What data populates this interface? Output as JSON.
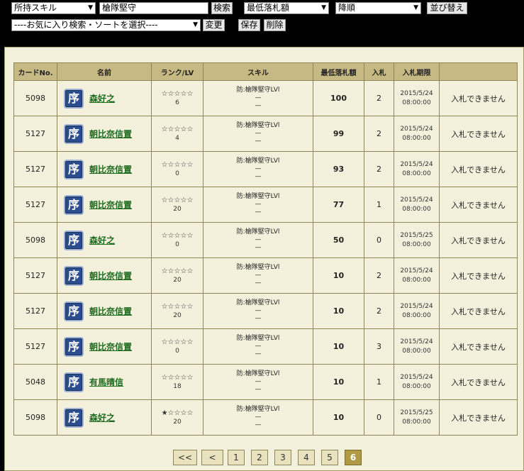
{
  "search": {
    "skill_select": "所持スキル",
    "skill_query": "槍隊堅守",
    "search_button": "検索",
    "sort_field": "最低落札額",
    "sort_order": "降順",
    "sort_button": "並び替え",
    "favorite_select": "----お気に入り検索・ソートを選択----",
    "change_button": "変更",
    "save_button": "保存",
    "delete_button": "削除"
  },
  "table": {
    "headers": [
      "カードNo.",
      "名前",
      "ランク/LV",
      "スキル",
      "最低落札額",
      "入札",
      "入札期限",
      ""
    ],
    "badge_text": "序",
    "rows": [
      {
        "card_no": "5098",
        "name": "森好之",
        "stars": "☆☆☆☆☆",
        "lv": "6",
        "skill1": "防:槍隊堅守LVl",
        "skill2": "—",
        "skill3": "—",
        "price": "100",
        "bids": "2",
        "end_date": "2015/5/24",
        "end_time": "08:00:00",
        "status": "入札できません"
      },
      {
        "card_no": "5127",
        "name": "朝比奈信置",
        "stars": "☆☆☆☆☆",
        "lv": "4",
        "skill1": "防:槍隊堅守LVl",
        "skill2": "—",
        "skill3": "—",
        "price": "99",
        "bids": "2",
        "end_date": "2015/5/24",
        "end_time": "08:00:00",
        "status": "入札できません"
      },
      {
        "card_no": "5127",
        "name": "朝比奈信置",
        "stars": "☆☆☆☆☆",
        "lv": "0",
        "skill1": "防:槍隊堅守LVl",
        "skill2": "—",
        "skill3": "—",
        "price": "93",
        "bids": "2",
        "end_date": "2015/5/24",
        "end_time": "08:00:00",
        "status": "入札できません"
      },
      {
        "card_no": "5127",
        "name": "朝比奈信置",
        "stars": "☆☆☆☆☆",
        "lv": "20",
        "skill1": "防:槍隊堅守LVl",
        "skill2": "—",
        "skill3": "—",
        "price": "77",
        "bids": "1",
        "end_date": "2015/5/24",
        "end_time": "08:00:00",
        "status": "入札できません"
      },
      {
        "card_no": "5098",
        "name": "森好之",
        "stars": "☆☆☆☆☆",
        "lv": "0",
        "skill1": "防:槍隊堅守LVl",
        "skill2": "—",
        "skill3": "—",
        "price": "50",
        "bids": "0",
        "end_date": "2015/5/25",
        "end_time": "08:00:00",
        "status": "入札できません"
      },
      {
        "card_no": "5127",
        "name": "朝比奈信置",
        "stars": "☆☆☆☆☆",
        "lv": "20",
        "skill1": "防:槍隊堅守LVl",
        "skill2": "—",
        "skill3": "—",
        "price": "10",
        "bids": "2",
        "end_date": "2015/5/24",
        "end_time": "08:00:00",
        "status": "入札できません"
      },
      {
        "card_no": "5127",
        "name": "朝比奈信置",
        "stars": "☆☆☆☆☆",
        "lv": "20",
        "skill1": "防:槍隊堅守LVl",
        "skill2": "—",
        "skill3": "—",
        "price": "10",
        "bids": "2",
        "end_date": "2015/5/24",
        "end_time": "08:00:00",
        "status": "入札できません"
      },
      {
        "card_no": "5127",
        "name": "朝比奈信置",
        "stars": "☆☆☆☆☆",
        "lv": "0",
        "skill1": "防:槍隊堅守LVl",
        "skill2": "—",
        "skill3": "—",
        "price": "10",
        "bids": "3",
        "end_date": "2015/5/24",
        "end_time": "08:00:00",
        "status": "入札できません"
      },
      {
        "card_no": "5048",
        "name": "有馬晴信",
        "stars": "☆☆☆☆☆",
        "lv": "18",
        "skill1": "防:槍隊堅守LVl",
        "skill2": "—",
        "skill3": "—",
        "price": "10",
        "bids": "1",
        "end_date": "2015/5/24",
        "end_time": "08:00:00",
        "status": "入札できません"
      },
      {
        "card_no": "5098",
        "name": "森好之",
        "stars": "★☆☆☆☆",
        "lv": "20",
        "skill1": "防:槍隊堅守LVl",
        "skill2": "—",
        "skill3": "—",
        "price": "10",
        "bids": "0",
        "end_date": "2015/5/25",
        "end_time": "08:00:00",
        "status": "入札できません"
      }
    ]
  },
  "pagination": {
    "first": "<<",
    "prev": "<",
    "pages": [
      "1",
      "2",
      "3",
      "4",
      "5",
      "6"
    ],
    "current": "6"
  }
}
